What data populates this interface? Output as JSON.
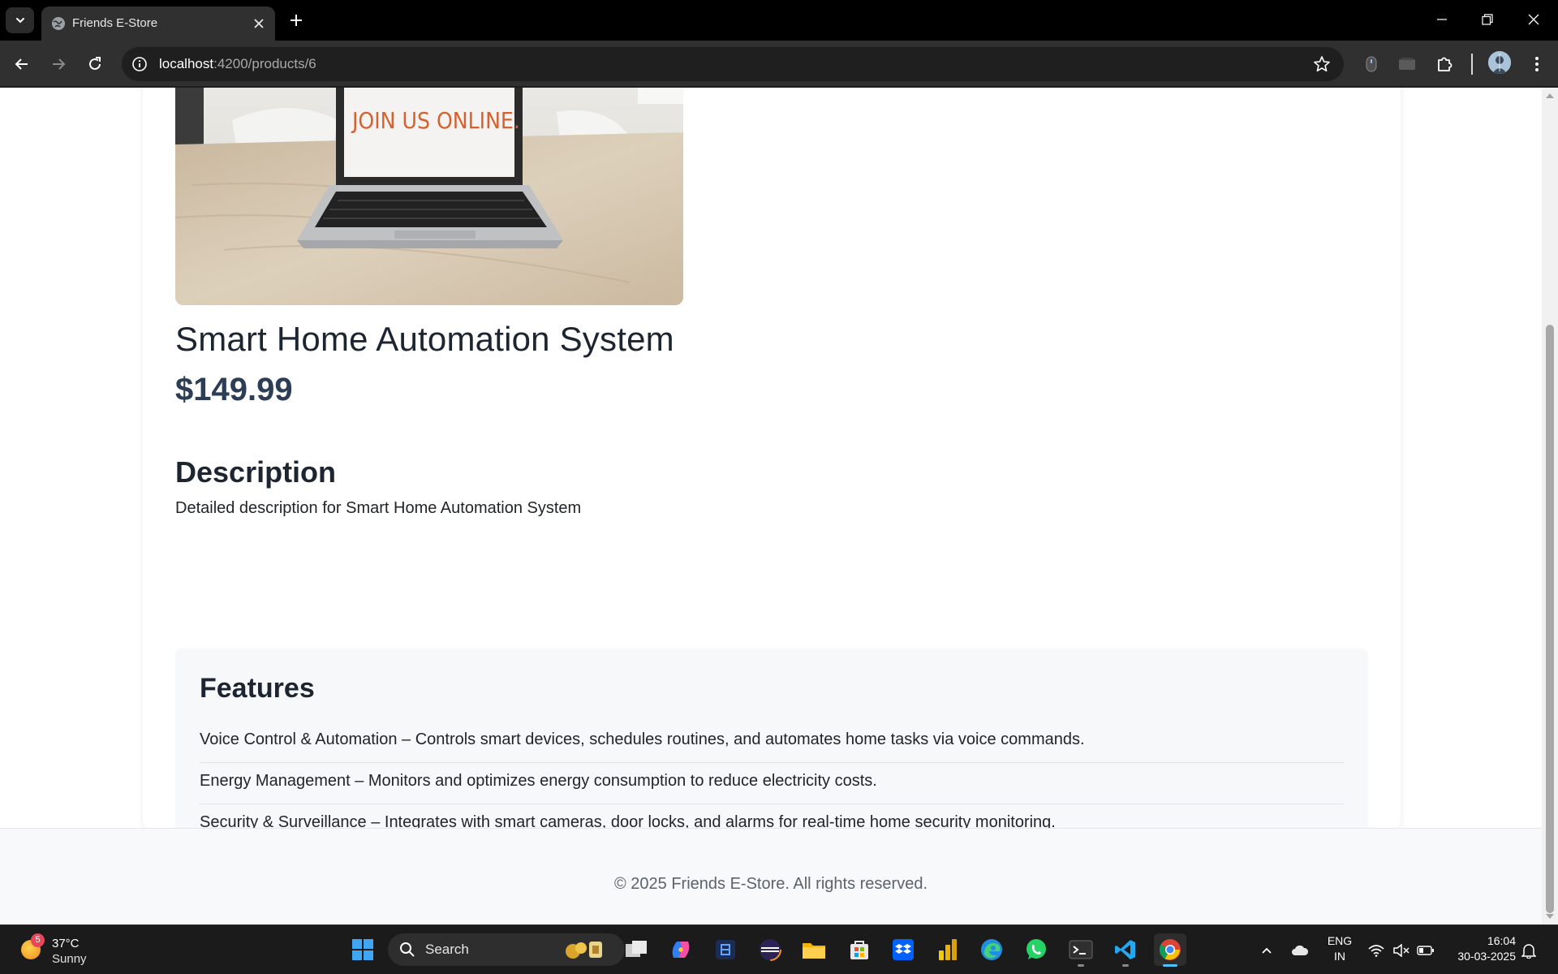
{
  "browser": {
    "tab_title": "Friends E-Store",
    "url_host": "localhost",
    "url_path": ":4200/products/6"
  },
  "product": {
    "image_text": "JOIN US ONLINE.",
    "title": "Smart Home Automation System",
    "price": "$149.99",
    "description_heading": "Description",
    "description": "Detailed description for Smart Home Automation System",
    "features_heading": "Features",
    "features": [
      "Voice Control & Automation – Controls smart devices, schedules routines, and automates home tasks via voice commands.",
      "Energy Management – Monitors and optimizes energy consumption to reduce electricity costs.",
      "Security & Surveillance – Integrates with smart cameras, door locks, and alarms for real-time home security monitoring."
    ]
  },
  "footer": {
    "text": "© 2025 Friends E-Store. All rights reserved."
  },
  "taskbar": {
    "weather_temp": "37°C",
    "weather_condition": "Sunny",
    "weather_badge": "5",
    "search_label": "Search",
    "lang_line1": "ENG",
    "lang_line2": "IN",
    "time": "16:04",
    "date": "30-03-2025"
  },
  "colors": {
    "accent_blue": "#4cc2ff",
    "price_color": "#2c3e55",
    "features_bg": "#f7f8fa"
  }
}
